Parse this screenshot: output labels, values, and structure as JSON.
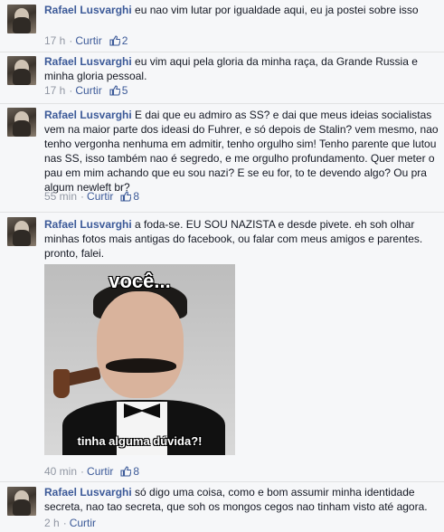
{
  "comments": [
    {
      "author": "Rafael Lusvarghi",
      "text": "eu nao vim lutar por igualdade aqui, eu ja postei sobre isso",
      "time": "17 h",
      "like_label": "Curtir",
      "likes": "2"
    },
    {
      "author": "Rafael Lusvarghi",
      "text": "eu vim aqui pela gloria da minha raça, da Grande Russia e minha gloria pessoal.",
      "time": "17 h",
      "like_label": "Curtir",
      "likes": "5"
    },
    {
      "author": "Rafael Lusvarghi",
      "text": "E dai que eu admiro as SS? e dai que meus ideias socialistas vem na maior parte dos ideasi do Fuhrer, e só depois de Stalin? vem mesmo, nao tenho vergonha nenhuma em admitir, tenho orgulho sim! Tenho parente que lutou nas SS, isso também nao é segredo, e me orgulho profundamento. Quer meter o pau em mim achando que eu sou nazi? E se eu for, to te devendo algo? Ou pra algum newleft br?",
      "time": "55 min",
      "like_label": "Curtir",
      "likes": "8"
    },
    {
      "author": "Rafael Lusvarghi",
      "text": "a foda-se. EU SOU NAZISTA e desde pivete. eh soh olhar minhas fotos mais antigas do facebook, ou falar com meus amigos e parentes. pronto, falei.",
      "time": "40 min",
      "like_label": "Curtir",
      "likes": "8",
      "image": {
        "caption_top": "você...",
        "caption_bottom": "tinha alguma dúvida?!"
      }
    },
    {
      "author": "Rafael Lusvarghi",
      "text": "só digo uma coisa, como e bom assumir minha identidade secreta, nao tao secreta, que soh os mongos cegos nao tinham visto até agora.",
      "time": "2 h",
      "like_label": "Curtir"
    }
  ],
  "colors": {
    "author": "#3b5998",
    "meta": "#9197a3",
    "background": "#f6f7f9"
  }
}
